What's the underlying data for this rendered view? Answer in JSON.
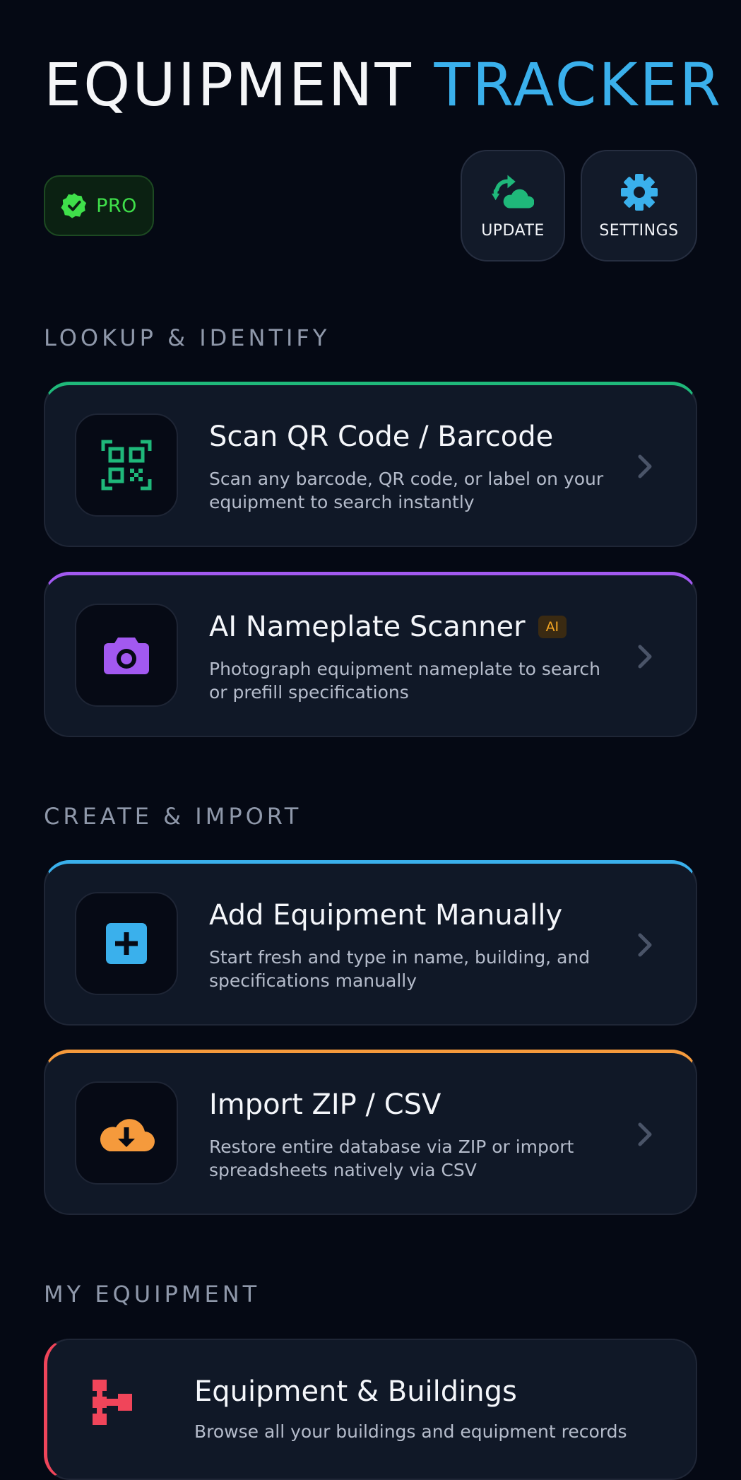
{
  "header": {
    "title_part1": "EQUIPMENT",
    "title_part2": "TRACKER"
  },
  "pro_badge": {
    "label": "PRO",
    "icon": "verified-check-icon"
  },
  "toolbar": {
    "update_label": "UPDATE",
    "update_icon": "cloud-sync-icon",
    "settings_label": "SETTINGS",
    "settings_icon": "gear-icon"
  },
  "sections": {
    "lookup": "LOOKUP & IDENTIFY",
    "create": "CREATE & IMPORT",
    "my_equipment": "MY EQUIPMENT"
  },
  "cards": {
    "scan": {
      "title": "Scan QR Code / Barcode",
      "description": "Scan any barcode, QR code, or label on your equipment to search instantly",
      "icon": "qr-code-icon",
      "accent": "#1fb87a"
    },
    "nameplate": {
      "title": "AI Nameplate Scanner",
      "badge": "AI",
      "description": "Photograph equipment nameplate to search or prefill specifications",
      "icon": "camera-icon",
      "accent": "#a259f0"
    },
    "add": {
      "title": "Add Equipment Manually",
      "description": "Start fresh and type in name, building, and specifications manually",
      "icon": "plus-square-icon",
      "accent": "#3ab0ec"
    },
    "import": {
      "title": "Import ZIP / CSV",
      "description": "Restore entire database via ZIP or import spreadsheets natively via CSV",
      "icon": "cloud-download-icon",
      "accent": "#f59a3c"
    },
    "buildings": {
      "title": "Equipment & Buildings",
      "description": "Browse all your buildings and equipment records",
      "icon": "hierarchy-icon",
      "accent": "#f0455a"
    }
  },
  "colors": {
    "background": "#050914",
    "card": "#101827",
    "brand_blue": "#3ab0ec",
    "pro_green": "#3fe04a"
  }
}
